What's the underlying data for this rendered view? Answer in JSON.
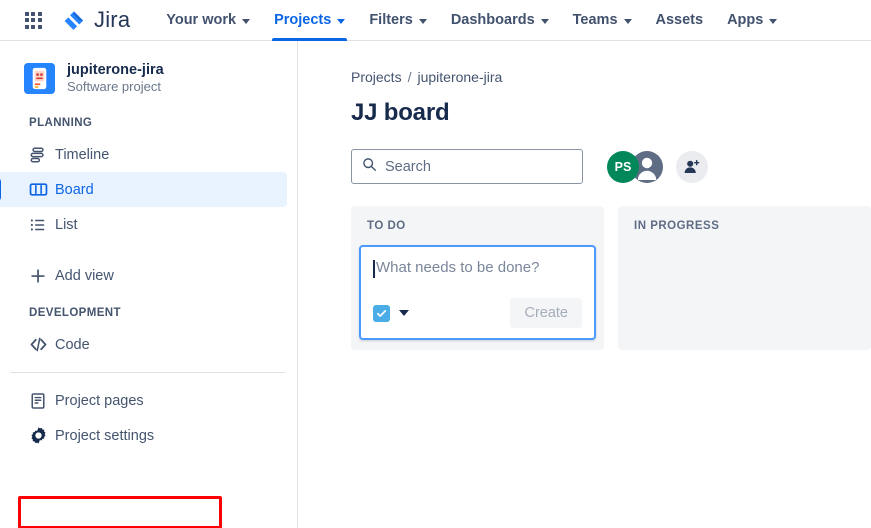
{
  "topnav": {
    "apps_icon": "apps-grid-icon",
    "brand": "Jira",
    "items": [
      {
        "label": "Your work",
        "has_chevron": true,
        "active": false
      },
      {
        "label": "Projects",
        "has_chevron": true,
        "active": true
      },
      {
        "label": "Filters",
        "has_chevron": true,
        "active": false
      },
      {
        "label": "Dashboards",
        "has_chevron": true,
        "active": false
      },
      {
        "label": "Teams",
        "has_chevron": true,
        "active": false
      },
      {
        "label": "Assets",
        "has_chevron": false,
        "active": false
      },
      {
        "label": "Apps",
        "has_chevron": true,
        "active": false
      }
    ]
  },
  "sidebar": {
    "project": {
      "name": "jupiterone-jira",
      "type": "Software project",
      "avatar_icon": "project-avatar-icon"
    },
    "sections": [
      {
        "label": "PLANNING",
        "items": [
          {
            "label": "Timeline",
            "icon": "timeline-icon",
            "selected": false
          },
          {
            "label": "Board",
            "icon": "board-icon",
            "selected": true
          },
          {
            "label": "List",
            "icon": "list-icon",
            "selected": false
          },
          {
            "label": "Add view",
            "icon": "plus-icon",
            "selected": false
          }
        ]
      },
      {
        "label": "DEVELOPMENT",
        "items": [
          {
            "label": "Code",
            "icon": "code-icon",
            "selected": false
          }
        ]
      }
    ],
    "footer_items": [
      {
        "label": "Project pages",
        "icon": "page-icon",
        "selected": false,
        "highlighted": false
      },
      {
        "label": "Project settings",
        "icon": "gear-icon",
        "selected": false,
        "highlighted": true
      }
    ],
    "highlight_color": "#ff0000"
  },
  "content": {
    "breadcrumb": {
      "root": "Projects",
      "separator": "/",
      "current": "jupiterone-jira"
    },
    "title": "JJ board",
    "search": {
      "placeholder": "Search",
      "value": "",
      "icon": "search-icon"
    },
    "avatars": [
      {
        "initials": "PS",
        "type": "initials",
        "color": "#00875a"
      },
      {
        "initials": "",
        "type": "person-icon",
        "color": "#5e6c84"
      }
    ],
    "add_people": {
      "icon": "add-person-icon",
      "label": ""
    },
    "columns": [
      {
        "title": "TO DO",
        "create_card": {
          "placeholder": "What needs to be done?",
          "value": "",
          "type_icon": "task-type-icon",
          "type_chevron_icon": "chevron-down-icon",
          "create_label": "Create",
          "create_disabled": true,
          "focused": true
        }
      },
      {
        "title": "IN PROGRESS",
        "create_card": null
      }
    ]
  }
}
